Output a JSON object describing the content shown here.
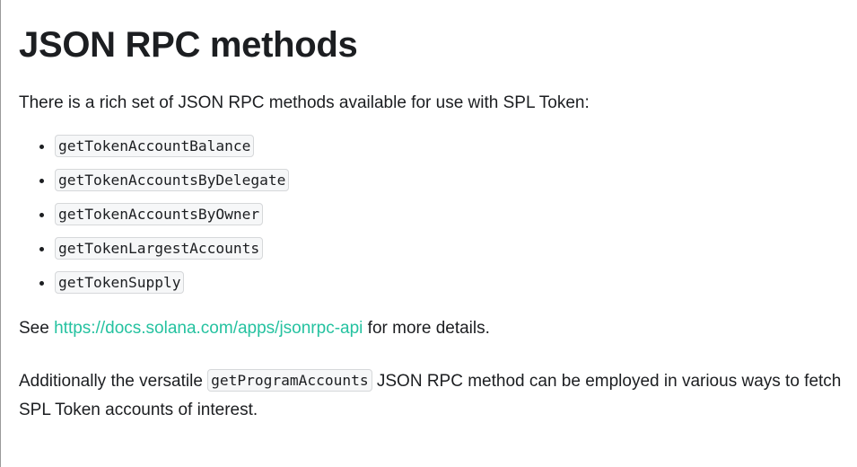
{
  "page": {
    "title": "JSON RPC methods",
    "intro": "There is a rich set of JSON RPC methods available for use with SPL Token:",
    "methods": [
      "getTokenAccountBalance",
      "getTokenAccountsByDelegate",
      "getTokenAccountsByOwner",
      "getTokenLargestAccounts",
      "getTokenSupply"
    ],
    "see_prefix": "See ",
    "see_link": "https://docs.solana.com/apps/jsonrpc-api",
    "see_suffix": " for more details.",
    "additional_prefix": "Additionally the versatile ",
    "additional_code": "getProgramAccounts",
    "additional_suffix": " JSON RPC method can be employed in various ways to fetch SPL Token accounts of interest."
  },
  "colors": {
    "link": "#25c2a0",
    "text": "#1c1e21",
    "code_bg": "#f6f7f8",
    "code_border": "#d6d8da"
  }
}
